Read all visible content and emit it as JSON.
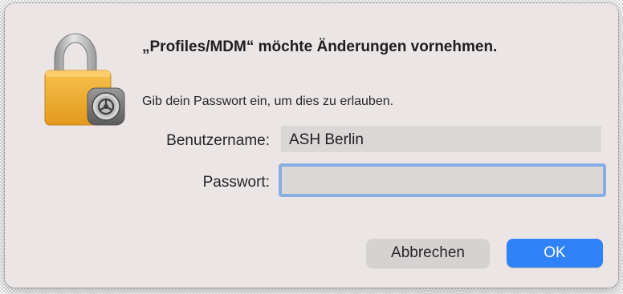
{
  "dialog": {
    "title": "„Profiles/MDM“ möchte Änderungen vornehmen.",
    "message": "Gib dein Passwort ein, um dies zu erlauben.",
    "icon": "lock-settings-icon"
  },
  "form": {
    "username_label": "Benutzername:",
    "username_value": "ASH Berlin",
    "password_label": "Passwort:",
    "password_value": ""
  },
  "buttons": {
    "cancel_label": "Abbrechen",
    "ok_label": "OK"
  },
  "colors": {
    "dialog_background": "#ebe5e5",
    "accent": "#2f82f7",
    "focus_ring": "#86aee2"
  }
}
